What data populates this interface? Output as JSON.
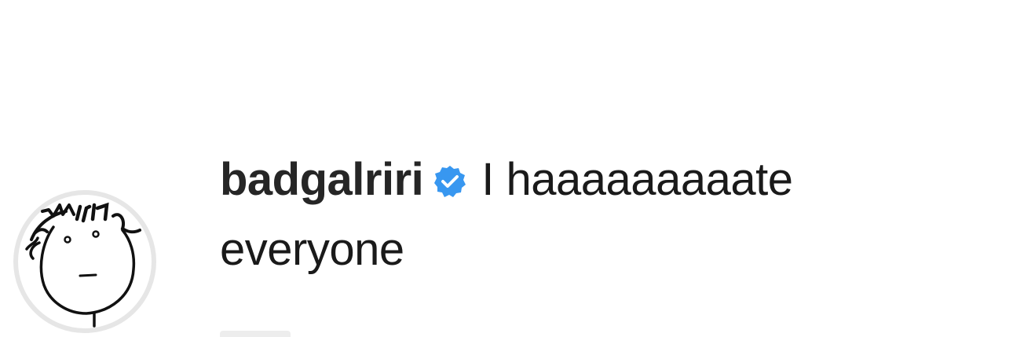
{
  "comment": {
    "username": "badgalriri",
    "verified_icon": "verified-badge-icon",
    "text": "I haaaaaaaaate everyone",
    "colors": {
      "verified_blue": "#3897f0",
      "username_text": "#262626",
      "body_text": "#1a1a1a"
    }
  },
  "avatar": {
    "icon": "doodle-face-avatar"
  }
}
